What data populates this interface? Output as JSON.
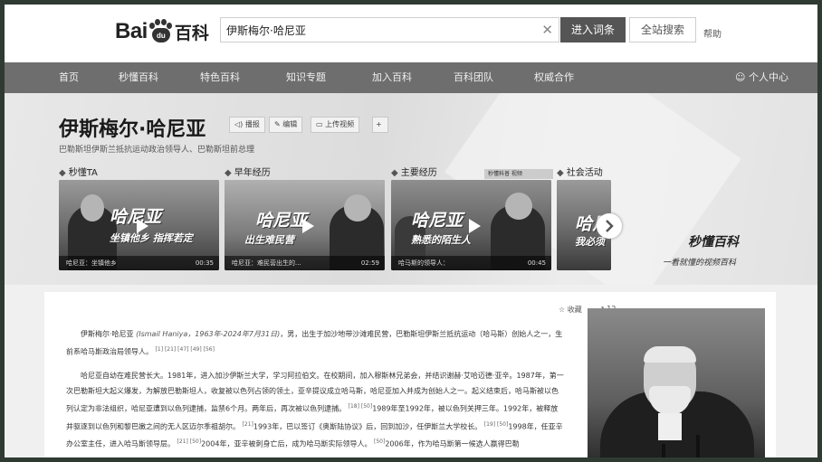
{
  "search": {
    "query": "伊斯梅尔·哈尼亚",
    "enter_label": "进入词条",
    "site_label": "全站搜索",
    "help_label": "帮助"
  },
  "logo": {
    "part1": "Bai",
    "paw": "du",
    "part2": "百科"
  },
  "nav": {
    "items": [
      "首页",
      "秒懂百科",
      "特色百科",
      "知识专题",
      "加入百科",
      "百科团队",
      "权威合作"
    ],
    "user_label": "个人中心"
  },
  "entry": {
    "title": "伊斯梅尔·哈尼亚",
    "subtitle": "巴勒斯坦伊斯兰抵抗运动政治领导人、巴勒斯坦前总理",
    "tools": [
      "播报",
      "编辑",
      "上传视频"
    ]
  },
  "videos": {
    "sections": [
      "秒懂TA",
      "早年经历",
      "主要经历",
      "社会活动"
    ],
    "cards": [
      {
        "big": "哈尼亚",
        "small": "坐镇他乡 指挥若定",
        "caption": "哈尼亚：坐镇他乡",
        "duration": "00:35"
      },
      {
        "big": "哈尼亚",
        "small": "出生难民营",
        "caption": "哈尼亚：难民营出生的...",
        "duration": "02:59"
      },
      {
        "big": "哈尼亚",
        "small": "熟悉的陌生人",
        "caption": "哈马斯的领导人：",
        "duration": "00:45"
      },
      {
        "big": "哈尼",
        "small": "我必须",
        "caption": "",
        "duration": ""
      }
    ],
    "badge": "秒懂科普 视频",
    "brand": "秒懂百科",
    "slogan": "一看就懂的视频百科"
  },
  "article": {
    "fav_label": "收藏",
    "share_count": "12",
    "para1": {
      "name": "伊斯梅尔·哈尼亚",
      "en": "(Ismail Haniya，1963年-2024年7月31日)",
      "text": "，男，出生于加沙地带沙滩难民营，巴勒斯坦伊斯兰抵抗运动（哈马斯）创始人之一，生前系哈马斯政治局领导人。",
      "refs": "[1] [21] [47] [49] [56]"
    },
    "para2": "哈尼亚自幼在难民营长大。1981年，进入加沙伊斯兰大学，学习阿拉伯文。在校期间，加入穆斯林兄弟会，并结识谢赫·艾哈迈德·亚辛。1987年，第一次巴勒斯坦大起义爆发，为解放巴勒斯坦人，收复被以色列占领的领土，亚辛提议成立哈马斯，哈尼亚加入并成为创始人之一。起义结束后，哈马斯被以色列认定为非法组织，哈尼亚遭到以色列逮捕，监禁6个月。两年后，再次被以色列逮捕。",
    "para3": "1989年至1992年，被以色列关押三年。1992年，被释放并驱逐到以色列和黎巴嫩之间的无人区迈尔季祖胡尔。",
    "para4": "1993年，巴以签订《奥斯陆协议》后，回到加沙，任伊斯兰大学校长。",
    "para5": "1998年，任亚辛办公室主任，进入哈马斯领导层。",
    "para6": "2004年，亚辛被刺身亡后，成为哈马斯实际领导人。",
    "para7": "2006年，作为哈马斯第一候选人赢得巴勒"
  }
}
